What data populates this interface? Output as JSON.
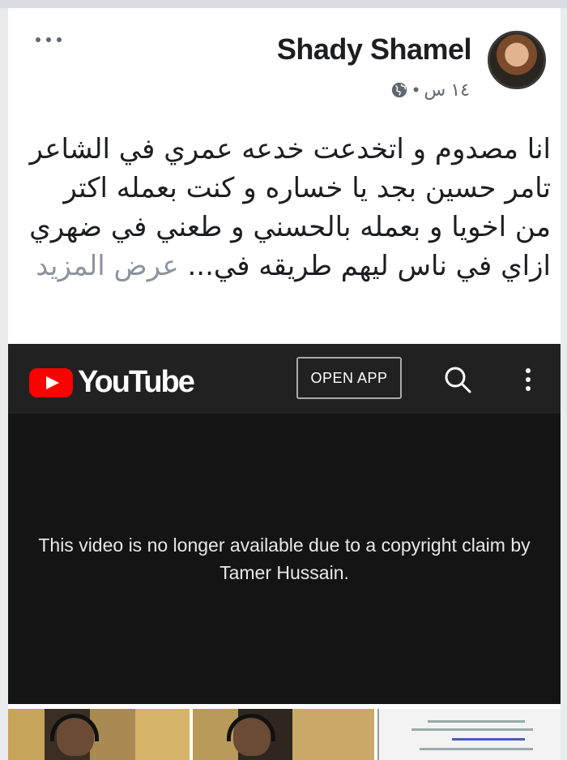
{
  "post": {
    "author_name": "Shady Shamel",
    "timestamp": "١٤ س",
    "dot": "•",
    "privacy_icon": "globe-icon",
    "text": "انا مصدوم و اتخدعت خدعه عمري  في الشاعر تامر حسين  بجد يا خساره  و كنت بعمله اكتر من اخويا  و بعمله بالحسني و طعني في ضهري  ازاي في ناس ليهم طريقه في...",
    "see_more": "عرض المزيد"
  },
  "youtube": {
    "logo_text": "YouTube",
    "open_app_label": "OPEN APP",
    "message": "This video is no longer available due to a copyright claim by Tamer Hussain.",
    "brand_color": "#ff0000"
  }
}
